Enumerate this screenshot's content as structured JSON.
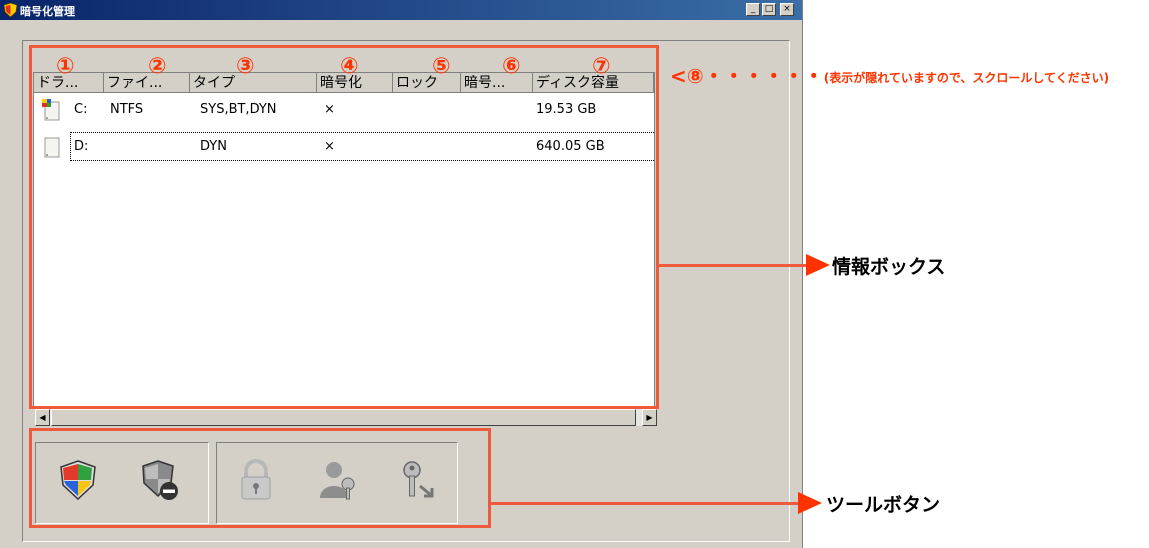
{
  "window": {
    "title": "暗号化管理",
    "minimize": "_",
    "maximize": "□",
    "close": "×"
  },
  "columns": [
    "ドラ...",
    "ファイ...",
    "タイプ",
    "暗号化",
    "ロック",
    "暗号...",
    "ディスク容量"
  ],
  "rows": [
    {
      "drive": "C:",
      "fs": "NTFS",
      "type": "SYS,BT,DYN",
      "encrypted": "×",
      "size": "19.53 GB"
    },
    {
      "drive": "D:",
      "fs": "",
      "type": "DYN",
      "encrypted": "×",
      "size": "640.05 GB"
    }
  ],
  "scrollbar": {
    "left": "◀",
    "right": "▶"
  },
  "toolbar": {
    "buttons": [
      "shield-encrypt-icon",
      "shield-remove-icon",
      "lock-icon",
      "user-key-icon",
      "key-arrow-icon"
    ]
  },
  "annotations": {
    "markers": [
      "①",
      "②",
      "③",
      "④",
      "⑤",
      "⑥",
      "⑦"
    ],
    "scroll_note_prefix": "<⑧・・・・・・",
    "scroll_note_text": "(表示が隠れていますので、スクロールしてください)",
    "info_box_label": "情報ボックス",
    "tool_button_label": "ツールボタン",
    "color": "#ff3300"
  }
}
